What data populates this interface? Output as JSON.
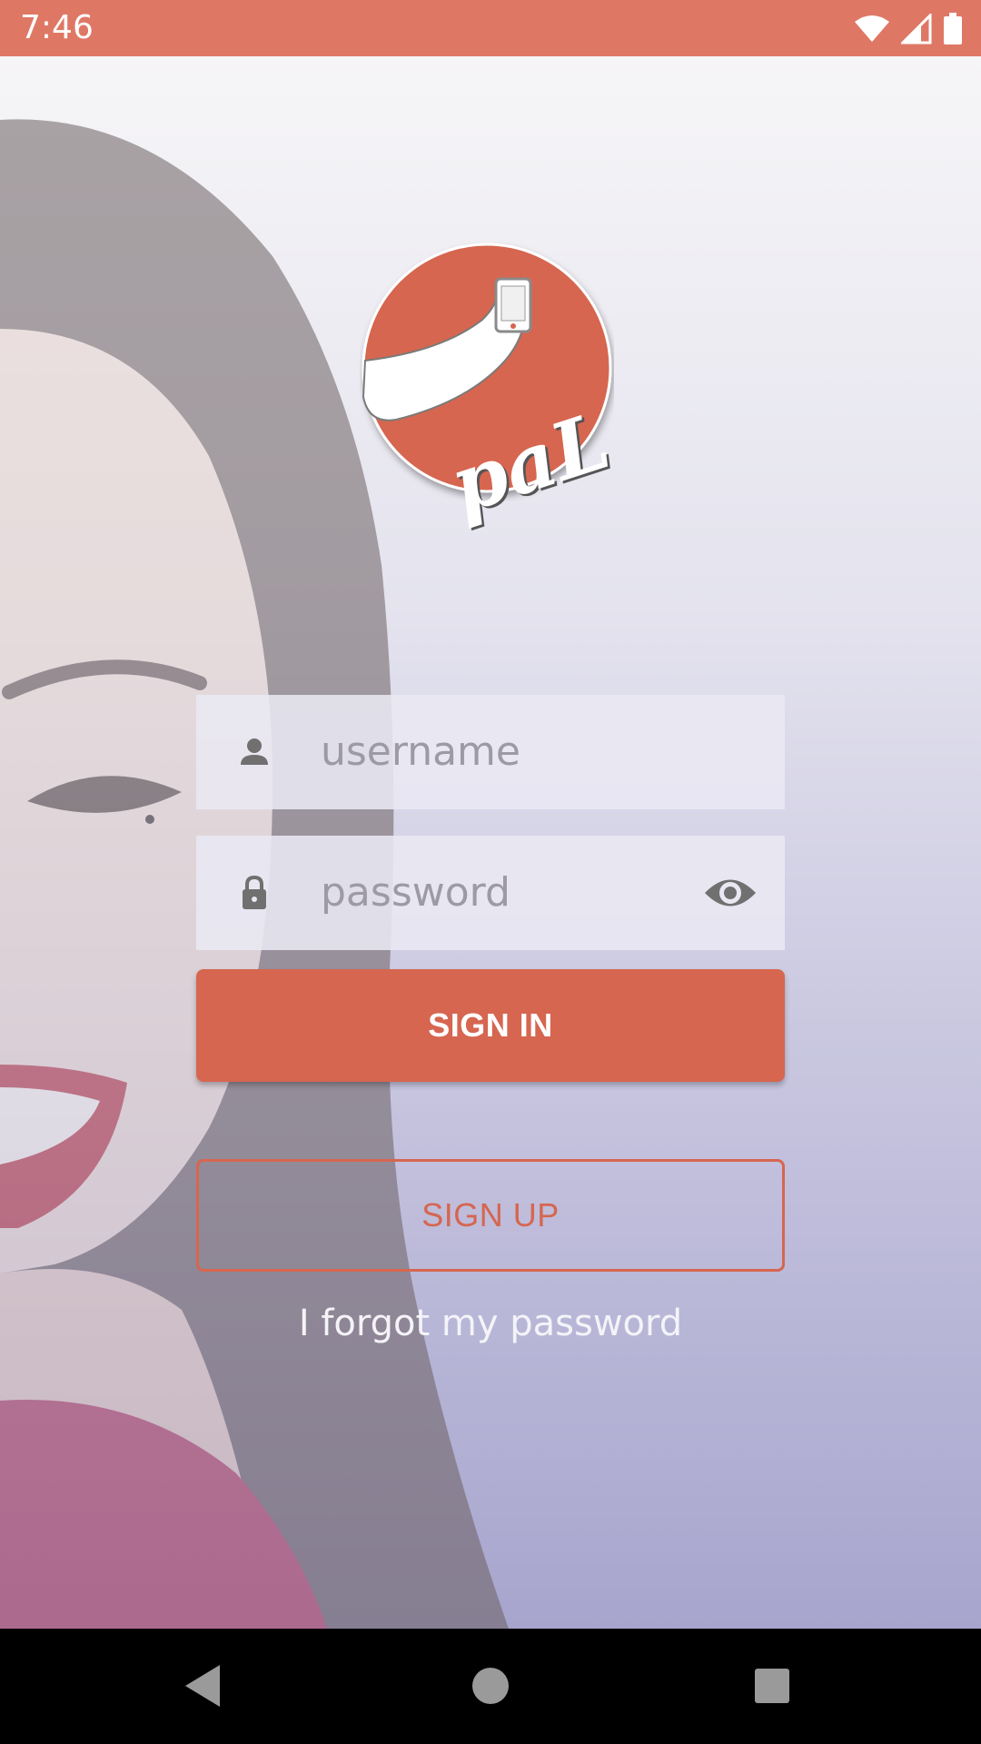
{
  "status_bar": {
    "time": "7:46",
    "icons": [
      "wifi-icon",
      "signal-icon",
      "battery-icon"
    ],
    "color": "#de7865"
  },
  "login": {
    "username_placeholder": "username",
    "password_placeholder": "password",
    "sign_in_label": "SIGN IN",
    "sign_up_label": "SIGN UP",
    "forgot_password_label": "I forgot my password"
  },
  "icons": {
    "username": "person-icon",
    "password": "lock-icon",
    "visibility": "eye-icon"
  },
  "logo": {
    "text": "paL"
  },
  "colors": {
    "accent": "#d66650"
  },
  "nav_bar": {
    "buttons": [
      "back-icon",
      "home-icon",
      "recents-icon"
    ]
  }
}
